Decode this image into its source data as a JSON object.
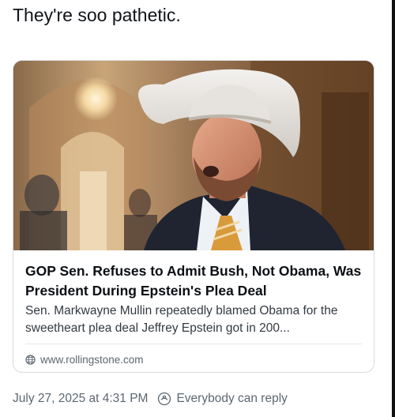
{
  "post": {
    "text": "They're soo pathetic."
  },
  "link_card": {
    "title": "GOP Sen. Refuses to Admit Bush, Not Obama, Was President During Epstein's Plea Deal",
    "description": "Sen. Markwayne Mullin repeatedly blamed Obama for the sweetheart plea deal Jeffrey Epstein got in 200...",
    "domain": "www.rollingstone.com",
    "domain_icon": "globe-icon"
  },
  "meta": {
    "timestamp": "July 27, 2025 at 4:31 PM",
    "reply_setting": "Everybody can reply",
    "reply_icon": "reply-settings-icon"
  }
}
